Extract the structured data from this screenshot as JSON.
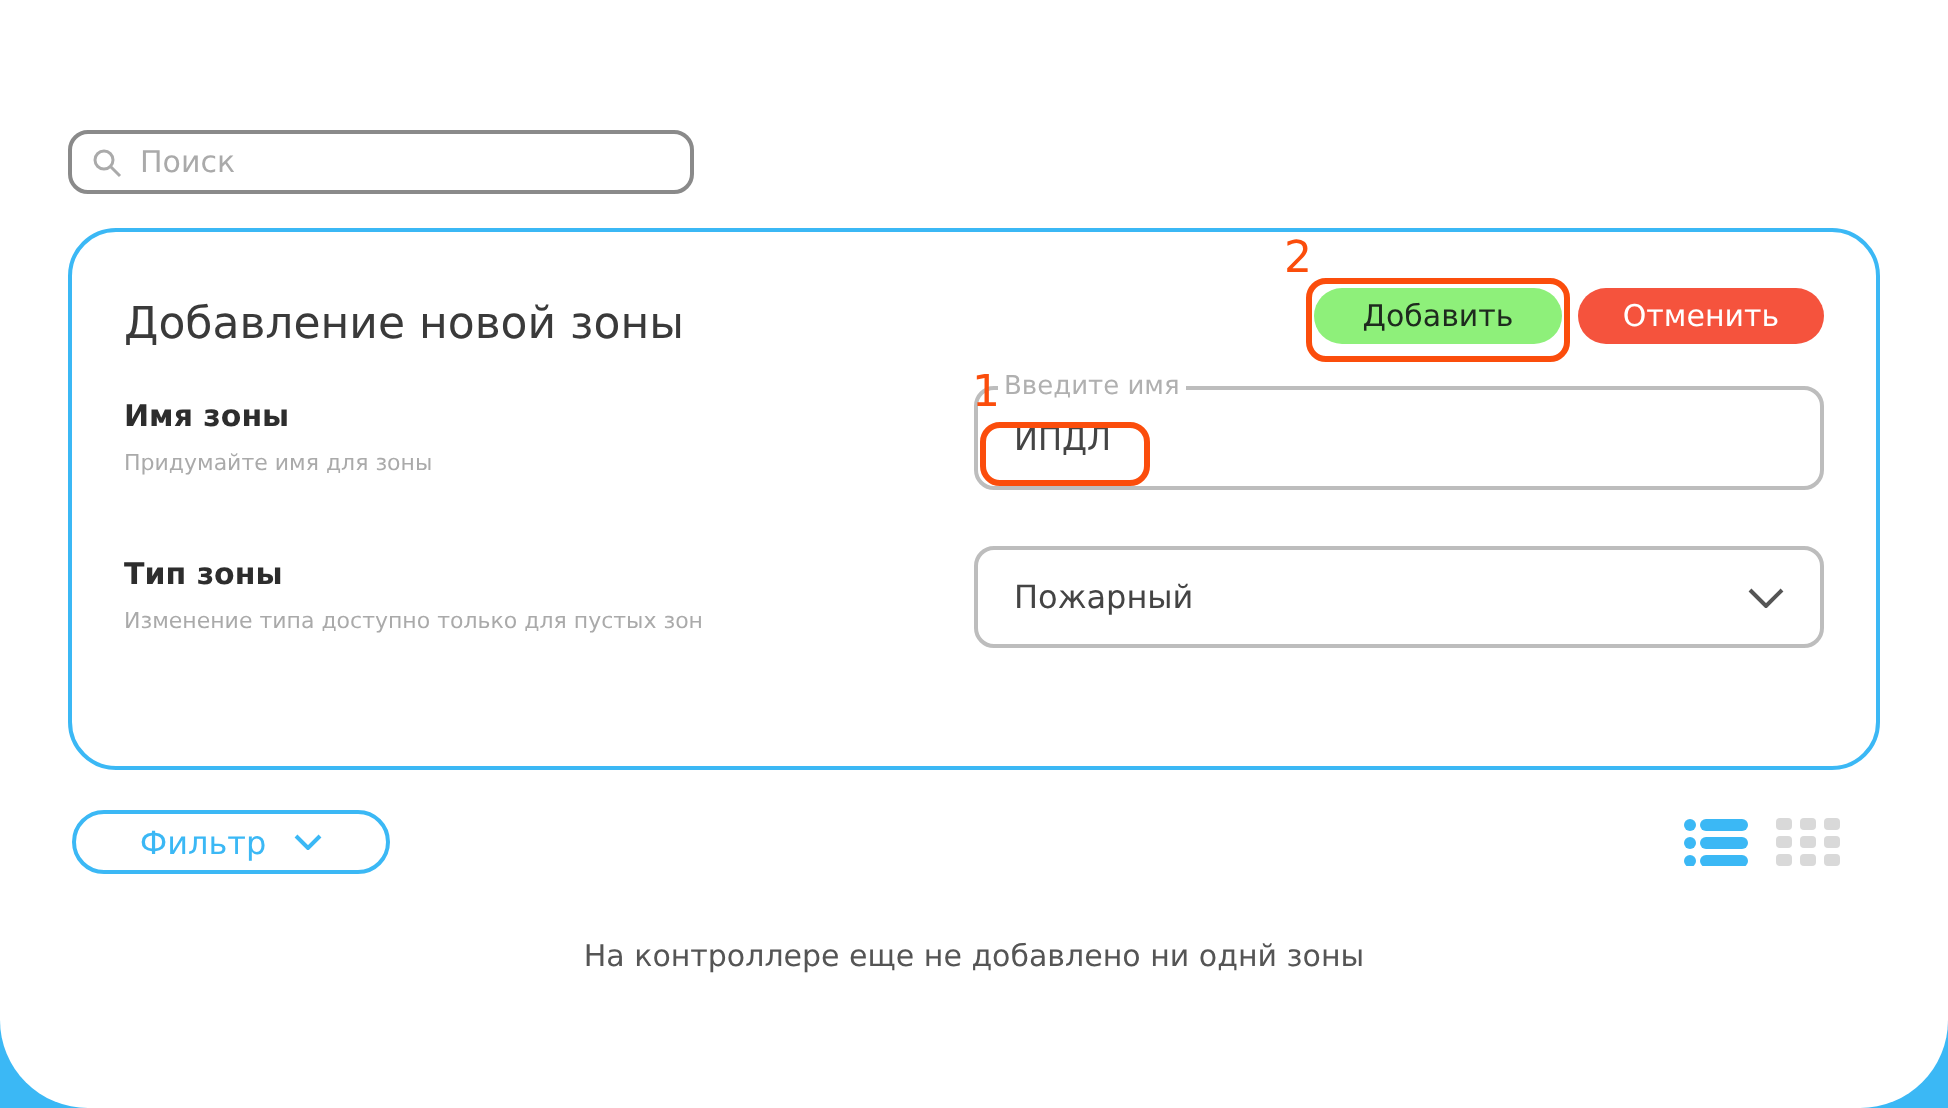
{
  "search": {
    "placeholder": "Поиск"
  },
  "form": {
    "title": "Добавление новой зоны",
    "buttons": [
      {
        "kind": "primary",
        "label": "Добавить"
      },
      {
        "kind": "danger",
        "label": "Отменить"
      }
    ],
    "fields": [
      {
        "kind": "text",
        "label": "Имя зоны",
        "hint": "Придумайте имя для зоны",
        "floating_label": "Введите имя",
        "value": "ИПДЛ"
      },
      {
        "kind": "select",
        "label": "Тип зоны",
        "hint": "Изменение типа доступно только для пустых зон",
        "value": "Пожарный"
      }
    ]
  },
  "filter": {
    "label": "Фильтр"
  },
  "view_toggles": [
    {
      "kind": "list",
      "selected": true
    },
    {
      "kind": "grid",
      "selected": false
    }
  ],
  "empty_message": "На контроллере еще не добавлено ни однй зоны",
  "annotations": [
    {
      "label": "1"
    },
    {
      "label": "2"
    }
  ]
}
